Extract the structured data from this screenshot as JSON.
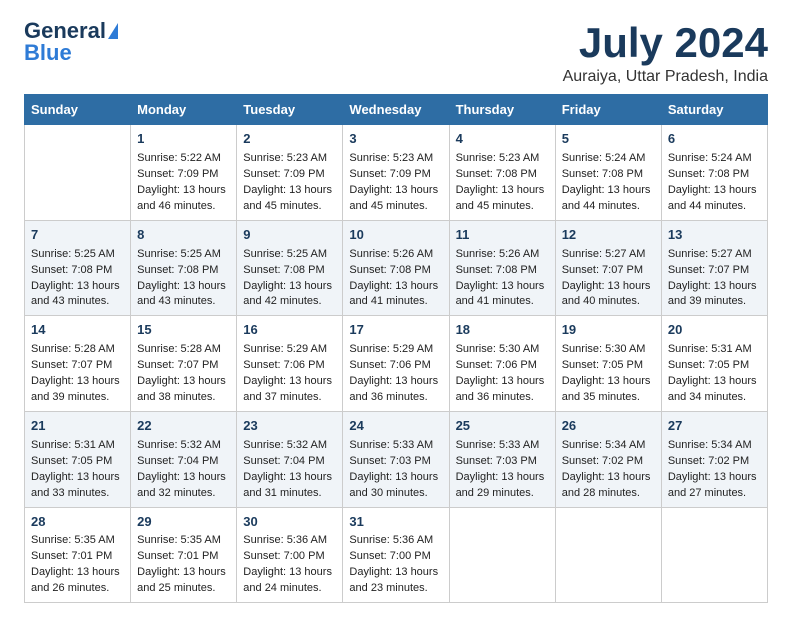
{
  "logo": {
    "general": "General",
    "blue": "Blue"
  },
  "title": "July 2024",
  "subtitle": "Auraiya, Uttar Pradesh, India",
  "days_header": [
    "Sunday",
    "Monday",
    "Tuesday",
    "Wednesday",
    "Thursday",
    "Friday",
    "Saturday"
  ],
  "weeks": [
    [
      {
        "num": "",
        "lines": []
      },
      {
        "num": "1",
        "lines": [
          "Sunrise: 5:22 AM",
          "Sunset: 7:09 PM",
          "Daylight: 13 hours",
          "and 46 minutes."
        ]
      },
      {
        "num": "2",
        "lines": [
          "Sunrise: 5:23 AM",
          "Sunset: 7:09 PM",
          "Daylight: 13 hours",
          "and 45 minutes."
        ]
      },
      {
        "num": "3",
        "lines": [
          "Sunrise: 5:23 AM",
          "Sunset: 7:09 PM",
          "Daylight: 13 hours",
          "and 45 minutes."
        ]
      },
      {
        "num": "4",
        "lines": [
          "Sunrise: 5:23 AM",
          "Sunset: 7:08 PM",
          "Daylight: 13 hours",
          "and 45 minutes."
        ]
      },
      {
        "num": "5",
        "lines": [
          "Sunrise: 5:24 AM",
          "Sunset: 7:08 PM",
          "Daylight: 13 hours",
          "and 44 minutes."
        ]
      },
      {
        "num": "6",
        "lines": [
          "Sunrise: 5:24 AM",
          "Sunset: 7:08 PM",
          "Daylight: 13 hours",
          "and 44 minutes."
        ]
      }
    ],
    [
      {
        "num": "7",
        "lines": [
          "Sunrise: 5:25 AM",
          "Sunset: 7:08 PM",
          "Daylight: 13 hours",
          "and 43 minutes."
        ]
      },
      {
        "num": "8",
        "lines": [
          "Sunrise: 5:25 AM",
          "Sunset: 7:08 PM",
          "Daylight: 13 hours",
          "and 43 minutes."
        ]
      },
      {
        "num": "9",
        "lines": [
          "Sunrise: 5:25 AM",
          "Sunset: 7:08 PM",
          "Daylight: 13 hours",
          "and 42 minutes."
        ]
      },
      {
        "num": "10",
        "lines": [
          "Sunrise: 5:26 AM",
          "Sunset: 7:08 PM",
          "Daylight: 13 hours",
          "and 41 minutes."
        ]
      },
      {
        "num": "11",
        "lines": [
          "Sunrise: 5:26 AM",
          "Sunset: 7:08 PM",
          "Daylight: 13 hours",
          "and 41 minutes."
        ]
      },
      {
        "num": "12",
        "lines": [
          "Sunrise: 5:27 AM",
          "Sunset: 7:07 PM",
          "Daylight: 13 hours",
          "and 40 minutes."
        ]
      },
      {
        "num": "13",
        "lines": [
          "Sunrise: 5:27 AM",
          "Sunset: 7:07 PM",
          "Daylight: 13 hours",
          "and 39 minutes."
        ]
      }
    ],
    [
      {
        "num": "14",
        "lines": [
          "Sunrise: 5:28 AM",
          "Sunset: 7:07 PM",
          "Daylight: 13 hours",
          "and 39 minutes."
        ]
      },
      {
        "num": "15",
        "lines": [
          "Sunrise: 5:28 AM",
          "Sunset: 7:07 PM",
          "Daylight: 13 hours",
          "and 38 minutes."
        ]
      },
      {
        "num": "16",
        "lines": [
          "Sunrise: 5:29 AM",
          "Sunset: 7:06 PM",
          "Daylight: 13 hours",
          "and 37 minutes."
        ]
      },
      {
        "num": "17",
        "lines": [
          "Sunrise: 5:29 AM",
          "Sunset: 7:06 PM",
          "Daylight: 13 hours",
          "and 36 minutes."
        ]
      },
      {
        "num": "18",
        "lines": [
          "Sunrise: 5:30 AM",
          "Sunset: 7:06 PM",
          "Daylight: 13 hours",
          "and 36 minutes."
        ]
      },
      {
        "num": "19",
        "lines": [
          "Sunrise: 5:30 AM",
          "Sunset: 7:05 PM",
          "Daylight: 13 hours",
          "and 35 minutes."
        ]
      },
      {
        "num": "20",
        "lines": [
          "Sunrise: 5:31 AM",
          "Sunset: 7:05 PM",
          "Daylight: 13 hours",
          "and 34 minutes."
        ]
      }
    ],
    [
      {
        "num": "21",
        "lines": [
          "Sunrise: 5:31 AM",
          "Sunset: 7:05 PM",
          "Daylight: 13 hours",
          "and 33 minutes."
        ]
      },
      {
        "num": "22",
        "lines": [
          "Sunrise: 5:32 AM",
          "Sunset: 7:04 PM",
          "Daylight: 13 hours",
          "and 32 minutes."
        ]
      },
      {
        "num": "23",
        "lines": [
          "Sunrise: 5:32 AM",
          "Sunset: 7:04 PM",
          "Daylight: 13 hours",
          "and 31 minutes."
        ]
      },
      {
        "num": "24",
        "lines": [
          "Sunrise: 5:33 AM",
          "Sunset: 7:03 PM",
          "Daylight: 13 hours",
          "and 30 minutes."
        ]
      },
      {
        "num": "25",
        "lines": [
          "Sunrise: 5:33 AM",
          "Sunset: 7:03 PM",
          "Daylight: 13 hours",
          "and 29 minutes."
        ]
      },
      {
        "num": "26",
        "lines": [
          "Sunrise: 5:34 AM",
          "Sunset: 7:02 PM",
          "Daylight: 13 hours",
          "and 28 minutes."
        ]
      },
      {
        "num": "27",
        "lines": [
          "Sunrise: 5:34 AM",
          "Sunset: 7:02 PM",
          "Daylight: 13 hours",
          "and 27 minutes."
        ]
      }
    ],
    [
      {
        "num": "28",
        "lines": [
          "Sunrise: 5:35 AM",
          "Sunset: 7:01 PM",
          "Daylight: 13 hours",
          "and 26 minutes."
        ]
      },
      {
        "num": "29",
        "lines": [
          "Sunrise: 5:35 AM",
          "Sunset: 7:01 PM",
          "Daylight: 13 hours",
          "and 25 minutes."
        ]
      },
      {
        "num": "30",
        "lines": [
          "Sunrise: 5:36 AM",
          "Sunset: 7:00 PM",
          "Daylight: 13 hours",
          "and 24 minutes."
        ]
      },
      {
        "num": "31",
        "lines": [
          "Sunrise: 5:36 AM",
          "Sunset: 7:00 PM",
          "Daylight: 13 hours",
          "and 23 minutes."
        ]
      },
      {
        "num": "",
        "lines": []
      },
      {
        "num": "",
        "lines": []
      },
      {
        "num": "",
        "lines": []
      }
    ]
  ]
}
